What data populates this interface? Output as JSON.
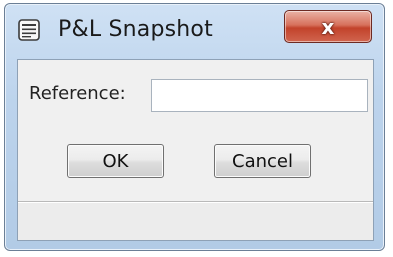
{
  "window": {
    "title": "P&L Snapshot",
    "icon": "document-icon",
    "close_label": "x"
  },
  "form": {
    "reference_label": "Reference:",
    "reference_value": "",
    "reference_placeholder": ""
  },
  "buttons": {
    "ok_label": "OK",
    "cancel_label": "Cancel"
  },
  "status": {
    "text": ""
  },
  "colors": {
    "titlebar": "#bcd3ec",
    "close_button": "#c2432b",
    "client_bg": "#f0f0f0"
  }
}
